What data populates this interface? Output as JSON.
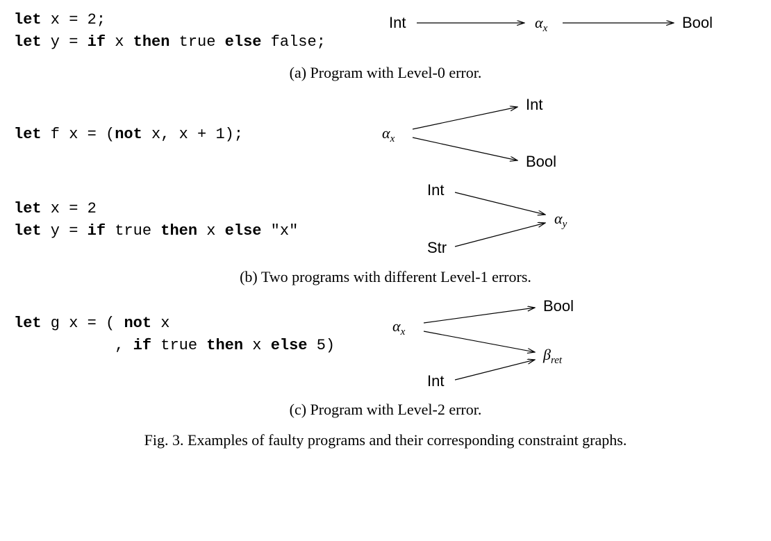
{
  "sections": {
    "a": {
      "code": [
        [
          {
            "t": "let",
            "b": true
          },
          {
            "t": " x = 2;",
            "b": false
          }
        ],
        [
          {
            "t": "let",
            "b": true
          },
          {
            "t": " y = ",
            "b": false
          },
          {
            "t": "if",
            "b": true
          },
          {
            "t": " x ",
            "b": false
          },
          {
            "t": "then",
            "b": true
          },
          {
            "t": " true ",
            "b": false
          },
          {
            "t": "else",
            "b": true
          },
          {
            "t": " false;",
            "b": false
          }
        ]
      ],
      "graph": {
        "nodes": {
          "int": {
            "label": "Int",
            "type": "sans"
          },
          "alpha": {
            "label": "α",
            "sub": "x",
            "type": "ital"
          },
          "bool": {
            "label": "Bool",
            "type": "sans"
          }
        }
      },
      "caption": "(a) Program with Level-0 error."
    },
    "b1": {
      "code": [
        [
          {
            "t": "let",
            "b": true
          },
          {
            "t": " f x = (",
            "b": false
          },
          {
            "t": "not",
            "b": true
          },
          {
            "t": " x, x + 1);",
            "b": false
          }
        ]
      ],
      "graph": {
        "nodes": {
          "alpha": {
            "label": "α",
            "sub": "x",
            "type": "ital"
          },
          "int": {
            "label": "Int",
            "type": "sans"
          },
          "bool": {
            "label": "Bool",
            "type": "sans"
          }
        }
      }
    },
    "b2": {
      "code": [
        [
          {
            "t": "let",
            "b": true
          },
          {
            "t": " x = 2",
            "b": false
          }
        ],
        [
          {
            "t": "let",
            "b": true
          },
          {
            "t": " y = ",
            "b": false
          },
          {
            "t": "if",
            "b": true
          },
          {
            "t": " true ",
            "b": false
          },
          {
            "t": "then",
            "b": true
          },
          {
            "t": " x ",
            "b": false
          },
          {
            "t": "else",
            "b": true
          },
          {
            "t": " \"x\"",
            "b": false
          }
        ]
      ],
      "graph": {
        "nodes": {
          "int": {
            "label": "Int",
            "type": "sans"
          },
          "str": {
            "label": "Str",
            "type": "sans"
          },
          "alpha": {
            "label": "α",
            "sub": "y",
            "type": "ital"
          }
        }
      }
    },
    "b_caption": "(b) Two programs with different Level-1 errors.",
    "c": {
      "code": [
        [
          {
            "t": "let",
            "b": true
          },
          {
            "t": " g x = ( ",
            "b": false
          },
          {
            "t": "not",
            "b": true
          },
          {
            "t": " x",
            "b": false
          }
        ],
        [
          {
            "t": "           , ",
            "b": false
          },
          {
            "t": "if",
            "b": true
          },
          {
            "t": " true ",
            "b": false
          },
          {
            "t": "then",
            "b": true
          },
          {
            "t": " x ",
            "b": false
          },
          {
            "t": "else",
            "b": true
          },
          {
            "t": " 5)",
            "b": false
          }
        ]
      ],
      "graph": {
        "nodes": {
          "alpha": {
            "label": "α",
            "sub": "x",
            "type": "ital"
          },
          "bool": {
            "label": "Bool",
            "type": "sans"
          },
          "beta": {
            "label": "β",
            "sub": "ret",
            "type": "ital"
          },
          "int": {
            "label": "Int",
            "type": "sans"
          }
        }
      },
      "caption": "(c) Program with Level-2 error."
    },
    "figure_caption": "Fig. 3.  Examples of faulty programs and their corresponding constraint graphs."
  }
}
